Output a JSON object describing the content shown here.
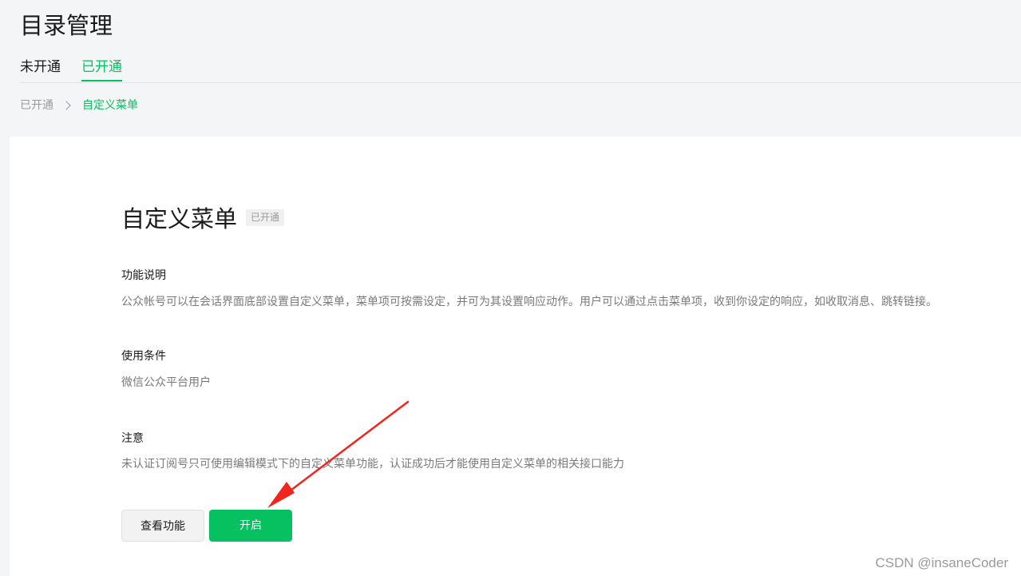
{
  "header": {
    "title": "目录管理"
  },
  "tabs": [
    {
      "label": "未开通",
      "active": false
    },
    {
      "label": "已开通",
      "active": true
    }
  ],
  "breadcrumb": {
    "parent": "已开通",
    "current": "自定义菜单"
  },
  "feature": {
    "title": "自定义菜单",
    "status": "已开通",
    "sections": [
      {
        "heading": "功能说明",
        "text": "公众帐号可以在会话界面底部设置自定义菜单，菜单项可按需设定，并可为其设置响应动作。用户可以通过点击菜单项，收到你设定的响应，如收取消息、跳转链接。"
      },
      {
        "heading": "使用条件",
        "text": "微信公众平台用户"
      },
      {
        "heading": "注意",
        "text": "未认证订阅号只可使用编辑模式下的自定义菜单功能，认证成功后才能使用自定义菜单的相关接口能力"
      }
    ],
    "buttons": {
      "view": "查看功能",
      "enable": "开启"
    }
  },
  "colors": {
    "accent": "#07c160",
    "annotation_arrow": "#f0261d"
  },
  "watermark": "CSDN @insaneCoder"
}
